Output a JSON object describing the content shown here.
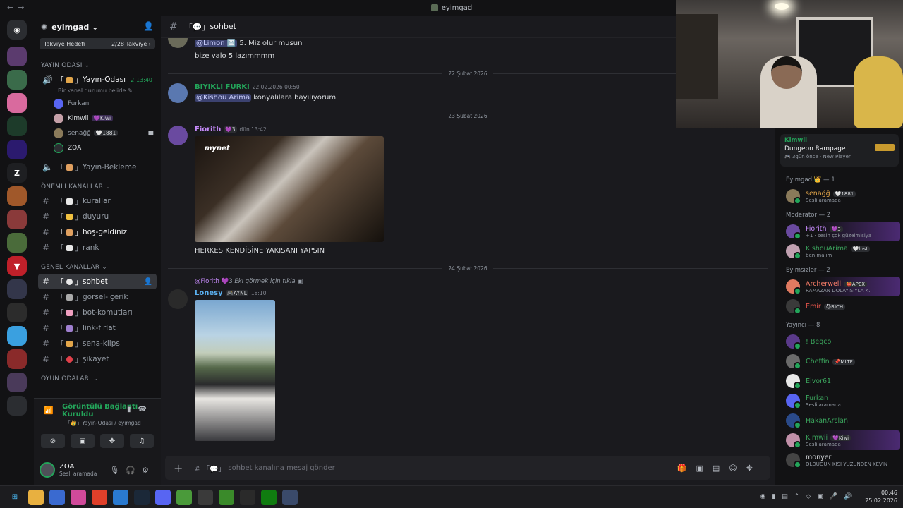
{
  "window": {
    "title": "eyimgad"
  },
  "server": {
    "name": "eyimgad",
    "boost_label": "Takviye Hedefi",
    "boost_value": "2/28 Takviye ›"
  },
  "categories": {
    "stream": "YAYIN ODASI ⌄",
    "important": "ÖNEMLİ KANALLAR ⌄",
    "general": "GENEL KANALLAR ⌄",
    "games": "OYUN ODALARI ⌄"
  },
  "voice": {
    "room": "Yayın-Odası",
    "timer": "2:13:40",
    "sub": "Bir kanal durumu belirle ✎",
    "users": [
      {
        "name": "Furkan",
        "badge": ""
      },
      {
        "name": "Kimwii",
        "badge": "💜Kiwi"
      },
      {
        "name": "senağğ",
        "badge": "🤍1881"
      },
      {
        "name": "ZOA",
        "badge": ""
      }
    ],
    "waiting": "Yayın-Bekleme"
  },
  "channels": {
    "important": [
      "kurallar",
      "duyuru",
      "hoş-geldiniz",
      "rank"
    ],
    "general": [
      "sohbet",
      "görsel-içerik",
      "bot-komutları",
      "link-fırlat",
      "sena-klips",
      "şikayet"
    ]
  },
  "voice_panel": {
    "title": "Görüntülü Bağlantı Kuruldu",
    "sub": "「👑」Yayın-Odası / eyimgad"
  },
  "user_panel": {
    "name": "ZOA",
    "status": "Sesli aramada"
  },
  "chat": {
    "channel": "sohbet",
    "msg0_mention": "@Limon 🈳",
    "msg0_text": " 5. Miz olur musun",
    "msg0_text2": "bize valo 5 lazımmmm",
    "date1": "22 Şubat 2026",
    "msg1_author": "BIYIKLI FURKİ",
    "msg1_time": "22.02.2026 00:50",
    "msg1_mention": "@Kishou Arima",
    "msg1_text": " konyalılara bayılıyorum",
    "date2": "23 Şubat 2026",
    "msg2_author": "Fiorith",
    "msg2_badge": "💜3",
    "msg2_time": "dün 13:42",
    "msg2_watermark": "mynet",
    "msg2_text": "HERKES KENDİSİNE YAKISANI YAPSIN",
    "date3": "24 Şubat 2026",
    "reply_author": "@Fiorith",
    "reply_badge": "💜3",
    "reply_text": "Eki görmek için tıkla",
    "msg3_author": "Lonesy",
    "msg3_badge": "🎮AYNL",
    "msg3_time": "18:10",
    "composer_placeholder": "sohbet kanalına mesaj gönder"
  },
  "members": {
    "activity": {
      "name": "Kimwii",
      "game": "Dungeon Rampage",
      "meta": "🎮 3gün önce · New Player"
    },
    "groups": [
      {
        "title": "Eyimgad 👑 — 1",
        "members": [
          {
            "name": "senağğ",
            "badge": "🤍1881",
            "status": "Sesli aramada",
            "color": "#e3a64a"
          }
        ]
      },
      {
        "title": "Moderatör — 2",
        "members": [
          {
            "name": "Fiorith",
            "badge": "💜3",
            "status": "+1 · sesin çok güzelmişiya",
            "color": "#c58af9"
          },
          {
            "name": "KishouArima",
            "badge": "🤍lost",
            "status": "ben malım",
            "color": "#3ba55d"
          }
        ]
      },
      {
        "title": "Eyimsizler — 2",
        "members": [
          {
            "name": "Archerwell",
            "badge": "👹APEX",
            "status": "RAMAZAN DOLAYISIYLA K.",
            "color": "#f47b67"
          },
          {
            "name": "Emir",
            "badge": "😈RICH",
            "status": "",
            "color": "#e0534a"
          }
        ]
      },
      {
        "title": "Yayıncı — 8",
        "members": [
          {
            "name": "! Beqco",
            "badge": "",
            "status": "",
            "color": "#3ba55d"
          },
          {
            "name": "Cheffin",
            "badge": "📌MLTF",
            "status": "",
            "color": "#3ba55d"
          },
          {
            "name": "Eivor61",
            "badge": "",
            "status": "",
            "color": "#3ba55d"
          },
          {
            "name": "Furkan",
            "badge": "",
            "status": "Sesli aramada",
            "color": "#3ba55d"
          },
          {
            "name": "HakanArslan",
            "badge": "",
            "status": "",
            "color": "#3ba55d"
          },
          {
            "name": "Kimwii",
            "badge": "💜Kiwi",
            "status": "Sesli aramada",
            "color": "#3ba55d"
          },
          {
            "name": "monyer",
            "badge": "",
            "status": "OLDUGUN KISI YUZUNDEN KEVIN",
            "color": "#dbdee1"
          }
        ]
      }
    ]
  },
  "clock": {
    "time": "00:46",
    "date": "25.02.2026"
  }
}
